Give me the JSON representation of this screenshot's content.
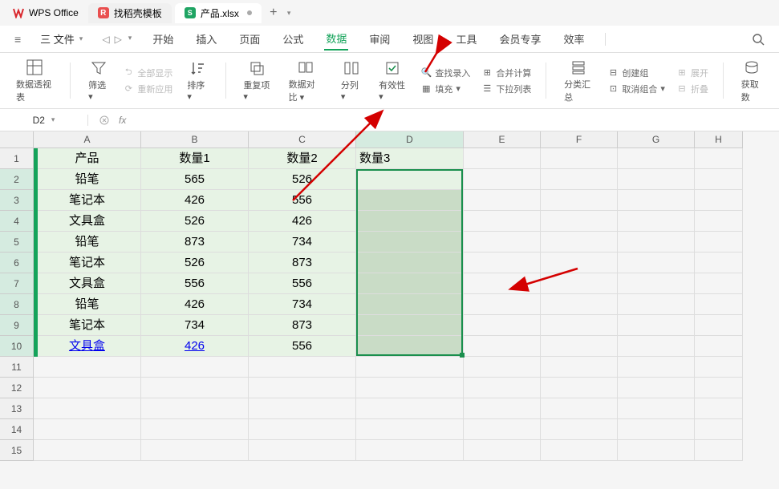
{
  "title_bar": {
    "app_name": "WPS Office",
    "tabs": [
      {
        "label": "找稻壳模板",
        "type": "template"
      },
      {
        "label": "产品.xlsx",
        "type": "sheet",
        "active": true
      }
    ]
  },
  "menu": {
    "file": "三 文件",
    "items": [
      "开始",
      "插入",
      "页面",
      "公式",
      "数据",
      "审阅",
      "视图",
      "工具",
      "会员专享",
      "效率"
    ],
    "active_index": 4
  },
  "ribbon": {
    "pivot": "数据透视表",
    "filter": "筛选",
    "show_all": "全部显示",
    "reapply": "重新应用",
    "sort": "排序",
    "dup": "重复项",
    "compare": "数据对比",
    "split": "分列",
    "valid": "有效性",
    "lookup": "查找录入",
    "fill": "填充",
    "merge": "合并计算",
    "dropdown": "下拉列表",
    "subtotal": "分类汇总",
    "group": "创建组",
    "ungroup": "取消组合",
    "expand": "展开",
    "collapse": "折叠",
    "getdata": "获取数"
  },
  "name_box": {
    "value": "D2"
  },
  "columns": [
    "A",
    "B",
    "C",
    "D",
    "E",
    "F",
    "G",
    "H"
  ],
  "rows": [
    1,
    2,
    3,
    4,
    5,
    6,
    7,
    8,
    9,
    10,
    11,
    12,
    13,
    14,
    15
  ],
  "data": {
    "headers": [
      "产品",
      "数量1",
      "数量2",
      "数量3"
    ],
    "rows": [
      [
        "铅笔",
        "565",
        "526",
        ""
      ],
      [
        "笔记本",
        "426",
        "556",
        ""
      ],
      [
        "文具盒",
        "526",
        "426",
        ""
      ],
      [
        "铅笔",
        "873",
        "734",
        ""
      ],
      [
        "笔记本",
        "526",
        "873",
        ""
      ],
      [
        "文具盒",
        "556",
        "556",
        ""
      ],
      [
        "铅笔",
        "426",
        "734",
        ""
      ],
      [
        "笔记本",
        "734",
        "873",
        ""
      ],
      [
        "文具盒",
        "426",
        "556",
        ""
      ]
    ]
  }
}
